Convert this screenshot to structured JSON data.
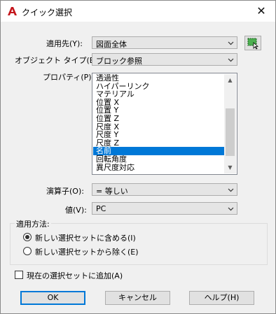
{
  "window": {
    "title": "クイック選択",
    "close_glyph": "✕"
  },
  "fields": {
    "apply_to_label": "適用先(Y):",
    "apply_to_value": "図面全体",
    "object_type_label": "オブジェクト タイプ(B):",
    "object_type_value": "ブロック参照",
    "properties_label": "プロパティ(P):",
    "operator_label": "演算子(O):",
    "operator_value": "= 等しい",
    "value_label": "値(V):",
    "value_value": "PC"
  },
  "properties": {
    "items": [
      "透過性",
      "ハイパーリンク",
      "マテリアル",
      "位置 X",
      "位置 Y",
      "位置 Z",
      "尺度 X",
      "尺度 Y",
      "尺度 Z",
      "名前",
      "回転角度",
      "異尺度対応"
    ],
    "selected_index": 9
  },
  "apply_method": {
    "group_label": "適用方法:",
    "options": [
      "新しい選択セットに含める(I)",
      "新しい選択セットから除く(E)"
    ],
    "selected_index": 0
  },
  "append": {
    "label": "現在の選択セットに追加(A)",
    "checked": false
  },
  "buttons": {
    "ok": "OK",
    "cancel": "キャンセル",
    "help": "ヘルプ(H)"
  },
  "colors": {
    "accent": "#0078d7",
    "app_icon": "#c4161c"
  }
}
